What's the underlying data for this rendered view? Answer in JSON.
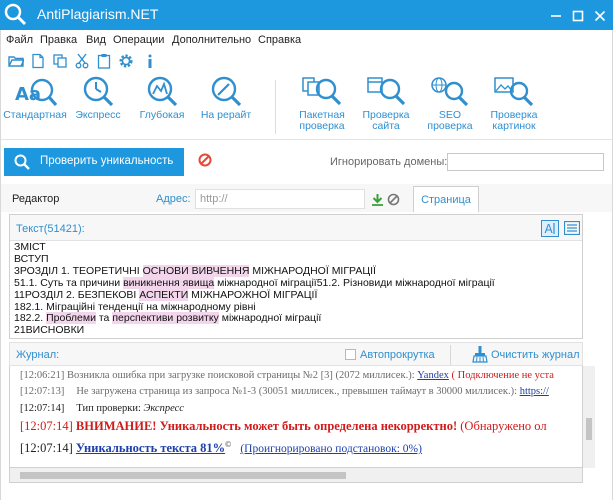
{
  "window": {
    "title": "AntiPlagiarism.NET",
    "accent_color": "#1d97de",
    "controls": [
      "minimize-icon",
      "maximize-icon",
      "close-icon"
    ]
  },
  "menu": [
    "Файл",
    "Правка",
    "Вид",
    "Операции",
    "Дополнительно",
    "Справка"
  ],
  "quick_toolbar_icons": [
    "open-folder-icon",
    "new-file-icon",
    "copy-icon",
    "cut-icon",
    "paste-icon",
    "settings-gear-icon",
    "info-icon"
  ],
  "ribbon": {
    "text_checks": [
      {
        "label": "Стандартная",
        "icon": "standard-check-icon"
      },
      {
        "label": "Экспресс",
        "icon": "express-check-icon"
      },
      {
        "label": "Глубокая",
        "icon": "deep-check-icon"
      },
      {
        "label": "На рерайт",
        "icon": "rewrite-check-icon"
      }
    ],
    "other_checks": [
      {
        "line1": "Пакетная",
        "line2": "проверка",
        "icon": "batch-check-icon"
      },
      {
        "line1": "Проверка",
        "line2": "сайта",
        "icon": "site-check-icon"
      },
      {
        "line1": "SEO",
        "line2": "проверка",
        "icon": "seo-check-icon"
      },
      {
        "line1": "Проверка",
        "line2": "картинок",
        "icon": "image-check-icon"
      }
    ]
  },
  "check": {
    "button_label": "Проверить уникальность",
    "ignore_domains_label": "Игнорировать домены:",
    "ignore_domains_value": ""
  },
  "editor": {
    "label": "Редактор",
    "address_label": "Адрес:",
    "address_placeholder": "http://",
    "tab_page": "Страница",
    "text_title": "Текст(51421):"
  },
  "text_lines": [
    [
      {
        "t": "ЗМІСТ"
      }
    ],
    [
      {
        "t": "ВСТУП"
      }
    ],
    [
      {
        "t": "3РОЗДІЛ 1. ТЕОРЕТИЧНІ "
      },
      {
        "t": "ОСНОВИ ВИВЧЕННЯ",
        "hl": true
      },
      {
        "t": " МІЖНАРОДНОЇ МІГРАЦІЇ"
      }
    ],
    [
      {
        "t": "51.1. Суть та причини "
      },
      {
        "t": "виникнення явища",
        "hl": true
      },
      {
        "t": " міжнародної міграції51.2. Різновиди міжнародної міграції"
      }
    ],
    [
      {
        "t": "11РОЗДІЛ 2. БЕЗПЕКОВІ "
      },
      {
        "t": "АСПЕКТИ",
        "hl": true
      },
      {
        "t": " МІЖНАРОЖНОЇ МІГРАЦІЇ"
      }
    ],
    [
      {
        "t": "182.1. Міграційні тенденції на міжнародному рівні"
      }
    ],
    [
      {
        "t": "182.2. "
      },
      {
        "t": "Проблеми",
        "hl": true
      },
      {
        "t": " та "
      },
      {
        "t": "перспективи розвитку",
        "hl": true
      },
      {
        "t": " міжнародної міграції"
      }
    ],
    [
      {
        "t": "21ВИСНОВКИ"
      }
    ]
  ],
  "journal": {
    "label": "Журнал:",
    "autoscroll_label": "Автопрокрутка",
    "autoscroll_checked": false,
    "clear_label": "Очистить журнал",
    "entries": {
      "e1": {
        "time": "[12:06:21]",
        "text": " Возникла ошибка при загрузке поисковой страницы №2 [3] (2072 миллисек.): ",
        "link": "Yandex",
        "tail": " ( Подключение не уста"
      },
      "e2": {
        "time": "[12:07:13]",
        "text": "Не загружена страница из запроса №1-3 (30051 миллисек., превышен таймаут в 30000 миллисек.): ",
        "link": "https://"
      },
      "e3": {
        "time": "[12:07:14]",
        "label": "Тип проверки: ",
        "value": "Экспресс"
      },
      "e4": {
        "time": "[12:07:14]",
        "warning": " ВНИМАНИЕ! Уникальность может быть определена некорректно!",
        "tail": " (Обнаружено ол"
      },
      "e5": {
        "time": "[12:07:14]",
        "uniqueness": "Уникальность текста 81%",
        "mark": "©",
        "ignored": "(Проигнорировано подстановок: 0%)"
      }
    }
  }
}
